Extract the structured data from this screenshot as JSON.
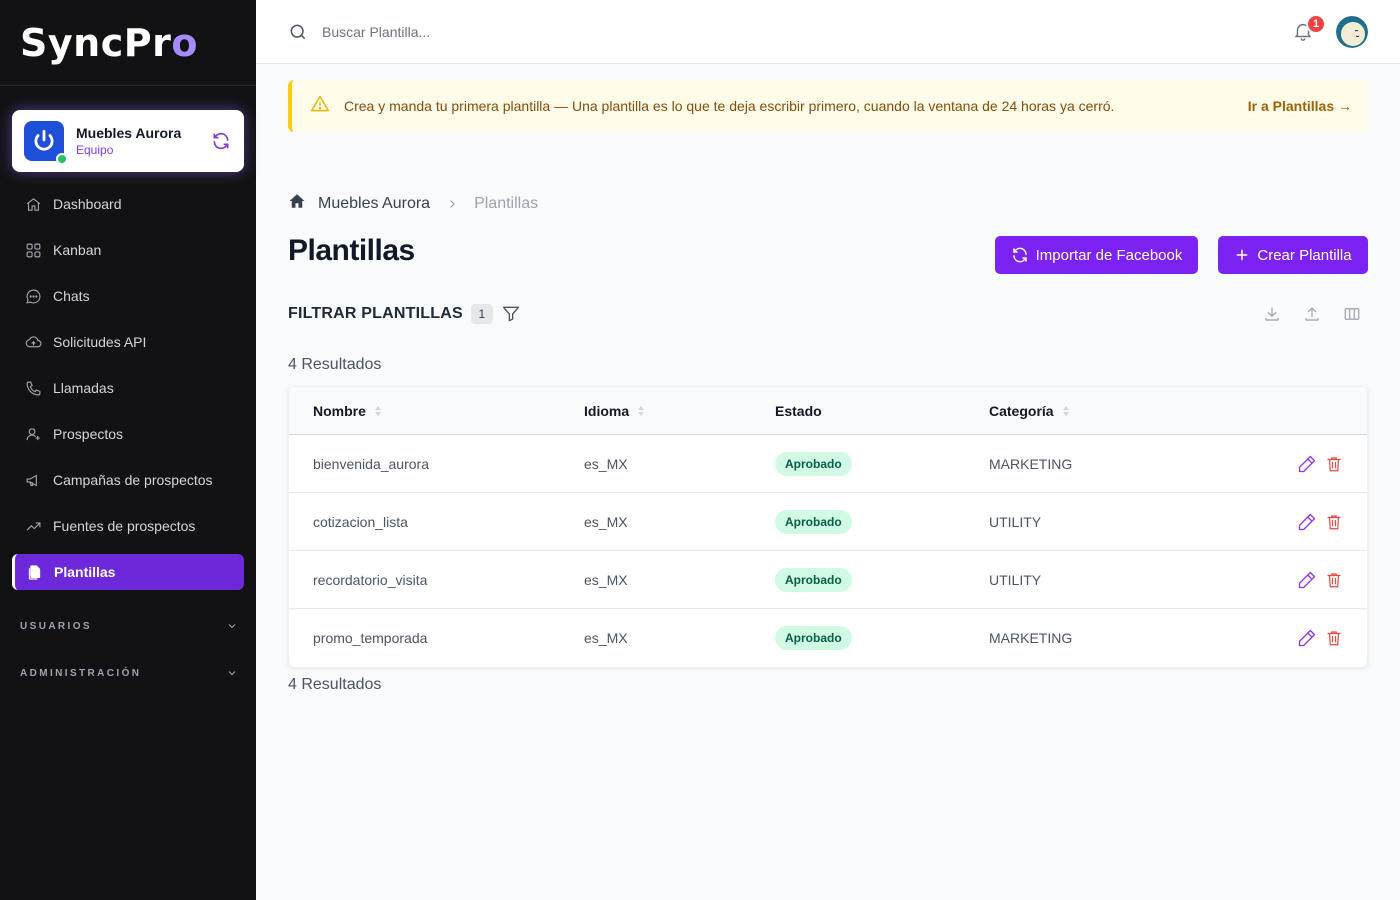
{
  "brand": {
    "name_part1": "SyncPr",
    "name_part2": "o"
  },
  "team": {
    "name": "Muebles Aurora",
    "role": "Equipo"
  },
  "nav": [
    {
      "label": "Dashboard",
      "icon": "home-icon"
    },
    {
      "label": "Kanban",
      "icon": "grid-icon"
    },
    {
      "label": "Chats",
      "icon": "chat-icon"
    },
    {
      "label": "Solicitudes API",
      "icon": "cloud-upload-icon"
    },
    {
      "label": "Llamadas",
      "icon": "phone-icon"
    },
    {
      "label": "Prospectos",
      "icon": "user-plus-icon"
    },
    {
      "label": "Campañas de prospectos",
      "icon": "megaphone-icon"
    },
    {
      "label": "Fuentes de prospectos",
      "icon": "trending-up-icon"
    },
    {
      "label": "Plantillas",
      "icon": "documents-icon",
      "active": true
    }
  ],
  "sections": [
    {
      "label": "USUARIOS"
    },
    {
      "label": "ADMINISTRACIÓN"
    }
  ],
  "search": {
    "placeholder": "Buscar Plantilla..."
  },
  "notifications": {
    "count": "1"
  },
  "alert": {
    "text": "Crea y manda tu primera plantilla — Una plantilla es lo que te deja escribir primero, cuando la ventana de 24 horas ya cerró.",
    "link": "Ir a Plantillas →"
  },
  "breadcrumb": {
    "home": "Muebles Aurora",
    "current": "Plantillas"
  },
  "page": {
    "title": "Plantillas"
  },
  "buttons": {
    "import": "Importar de Facebook",
    "create": "Crear Plantilla"
  },
  "filter": {
    "title": "FILTRAR PLANTILLAS",
    "count": "1"
  },
  "results": {
    "top": "4 Resultados",
    "bottom": "4 Resultados"
  },
  "table": {
    "columns": [
      "Nombre",
      "Idioma",
      "Estado",
      "Categoría"
    ],
    "rows": [
      {
        "name": "bienvenida_aurora",
        "lang": "es_MX",
        "status": "Aprobado",
        "category": "MARKETING"
      },
      {
        "name": "cotizacion_lista",
        "lang": "es_MX",
        "status": "Aprobado",
        "category": "UTILITY"
      },
      {
        "name": "recordatorio_visita",
        "lang": "es_MX",
        "status": "Aprobado",
        "category": "UTILITY"
      },
      {
        "name": "promo_temporada",
        "lang": "es_MX",
        "status": "Aprobado",
        "category": "MARKETING"
      }
    ]
  },
  "colors": {
    "accent": "#7c22f2",
    "sidebar": "#121214",
    "success": "#d1fae5",
    "danger": "#ef4444"
  }
}
